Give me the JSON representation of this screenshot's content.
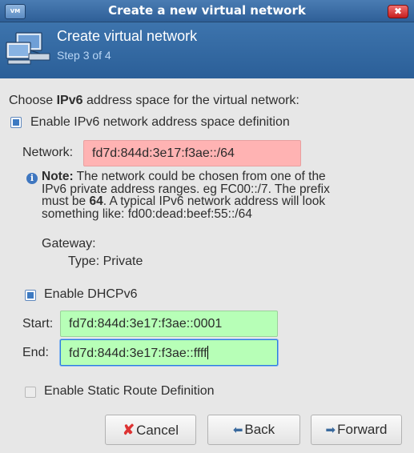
{
  "window": {
    "title": "Create a new virtual network",
    "icon_text": "VM",
    "close_glyph": "✖"
  },
  "banner": {
    "title": "Create virtual network",
    "step": "Step 3 of 4",
    "icon": "network-computers-icon"
  },
  "page": {
    "intro_prefix": "Choose ",
    "intro_bold": "IPv6",
    "intro_suffix": " address space for the virtual network:",
    "enable_ipv6_label": "Enable IPv6 network address space definition",
    "enable_ipv6_checked": true,
    "network_label": "Network:",
    "network_value": "fd7d:844d:3e17:f3ae::/64",
    "note_bold": "Note:",
    "note_line1": " The network could be chosen from one of the",
    "note_line2": "IPv6 private address ranges. eg FC00::/7.  The prefix",
    "note_line3_prefix": "must be ",
    "note_line3_bold": "64",
    "note_line3_suffix": ". A typical IPv6 network address will look",
    "note_line4": "something like:  fd00:dead:beef:55::/64",
    "gateway_label": "Gateway:",
    "type_label": "Type:",
    "type_value": "Private",
    "enable_dhcp_label": "Enable DHCPv6",
    "enable_dhcp_checked": true,
    "start_label": "Start:",
    "start_value": "fd7d:844d:3e17:f3ae::0001",
    "end_label": "End:",
    "end_value": "fd7d:844d:3e17:f3ae::ffff",
    "static_route_label": "Enable Static Route Definition",
    "static_route_checked": false
  },
  "buttons": {
    "cancel": "Cancel",
    "back": "Back",
    "forward": "Forward"
  },
  "icons": {
    "info": "info-icon",
    "cancel": "cancel-x-icon",
    "back": "back-arrow-icon",
    "forward": "forward-arrow-icon"
  },
  "colors": {
    "title_bar": "#2f5f97",
    "banner": "#3d74ad",
    "invalid_field": "#ffb3b3",
    "valid_field": "#b7ffb7",
    "accent": "#3d7ac2"
  }
}
